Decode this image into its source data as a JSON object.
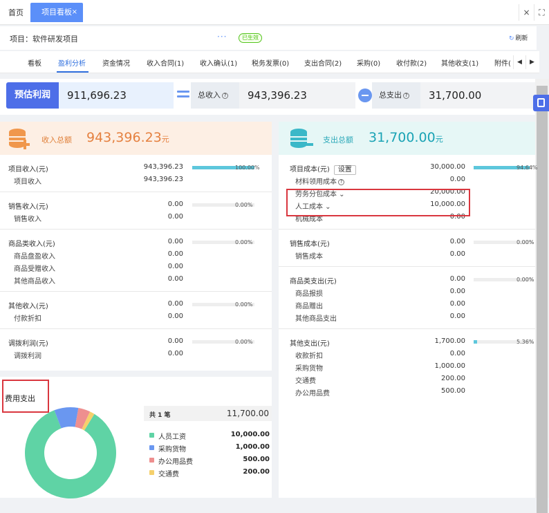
{
  "tabs": {
    "home": "首页",
    "active": "项目看板",
    "close": "×"
  },
  "window_controls": {
    "close": "×",
    "maximize": "⛶"
  },
  "project": {
    "label": "项目：软件研发项目",
    "more": "···",
    "status": "已生效",
    "refresh": "刷新"
  },
  "nav": {
    "items": [
      "看板",
      "盈利分析",
      "资金情况",
      "收入合同(1)",
      "收入确认(1)",
      "税务发票(0)",
      "支出合同(2)",
      "采购(0)",
      "收付款(2)",
      "其他收支(1)",
      "附件("
    ],
    "active_index": 1,
    "prev": "◀",
    "next": "▶"
  },
  "summary": {
    "profit_label": "预估利润",
    "profit_value": "911,696.23",
    "income_label": "总收入",
    "income_value": "943,396.23",
    "expense_label": "总支出",
    "expense_value": "31,700.00",
    "help": "?"
  },
  "income_panel": {
    "title": "收入总额",
    "total": "943,396.23",
    "unit": "元",
    "groups": [
      {
        "label": "项目收入(元)",
        "value": "943,396.23",
        "pct": "100.00%",
        "fill": 1.0,
        "subs": [
          {
            "label": "项目收入",
            "value": "943,396.23"
          }
        ]
      },
      {
        "label": "销售收入(元)",
        "value": "0.00",
        "pct": "0.00%",
        "fill": 0,
        "subs": [
          {
            "label": "销售收入",
            "value": "0.00"
          }
        ]
      },
      {
        "label": "商品类收入(元)",
        "value": "0.00",
        "pct": "0.00%",
        "fill": 0,
        "subs": [
          {
            "label": "商品盘盈收入",
            "value": "0.00"
          },
          {
            "label": "商品受赠收入",
            "value": "0.00"
          },
          {
            "label": "其他商品收入",
            "value": "0.00"
          }
        ]
      },
      {
        "label": "其他收入(元)",
        "value": "0.00",
        "pct": "0.00%",
        "fill": 0,
        "subs": [
          {
            "label": "付款折扣",
            "value": "0.00"
          }
        ]
      },
      {
        "label": "调拨利润(元)",
        "value": "0.00",
        "pct": "0.00%",
        "fill": 0,
        "subs": [
          {
            "label": "调拨利润",
            "value": "0.00"
          }
        ]
      }
    ]
  },
  "expense_panel": {
    "title": "支出总额",
    "total": "31,700.00",
    "unit": "元",
    "settings": "设置",
    "groups": [
      {
        "label": "项目成本(元)",
        "value": "30,000.00",
        "pct": "94.64%",
        "fill": 0.9464,
        "subs": [
          {
            "label": "材料领用成本",
            "value": "0.00"
          },
          {
            "label": "劳务分包成本",
            "value": "20,000.00"
          },
          {
            "label": "人工成本",
            "value": "10,000.00"
          },
          {
            "label": "机械成本",
            "value": "0.00"
          }
        ]
      },
      {
        "label": "销售成本(元)",
        "value": "0.00",
        "pct": "0.00%",
        "fill": 0,
        "subs": [
          {
            "label": "销售成本",
            "value": "0.00"
          }
        ]
      },
      {
        "label": "商品类支出(元)",
        "value": "0.00",
        "pct": "0.00%",
        "fill": 0,
        "subs": [
          {
            "label": "商品报损",
            "value": "0.00"
          },
          {
            "label": "商品赠出",
            "value": "0.00"
          },
          {
            "label": "其他商品支出",
            "value": "0.00"
          }
        ]
      },
      {
        "label": "其他支出(元)",
        "value": "1,700.00",
        "pct": "5.36%",
        "fill": 0.0536,
        "subs": [
          {
            "label": "收款折扣",
            "value": "0.00"
          },
          {
            "label": "采购货物",
            "value": "1,000.00"
          },
          {
            "label": "交通费",
            "value": "200.00"
          },
          {
            "label": "办公用品费",
            "value": "500.00"
          }
        ]
      }
    ]
  },
  "fee": {
    "title": "费用支出",
    "count_label": "共 1 笔",
    "total": "11,700.00",
    "colors": {
      "people": "#5fd3a5",
      "purchase": "#6a97f0",
      "office": "#ee8f8f",
      "traffic": "#f5d06c"
    },
    "items": [
      {
        "label": "人员工资",
        "value": "10,000.00",
        "amount": 10000
      },
      {
        "label": "采购货物",
        "value": "1,000.00",
        "amount": 1000
      },
      {
        "label": "办公用品费",
        "value": "500.00",
        "amount": 500
      },
      {
        "label": "交通费",
        "value": "200.00",
        "amount": 200
      }
    ]
  }
}
